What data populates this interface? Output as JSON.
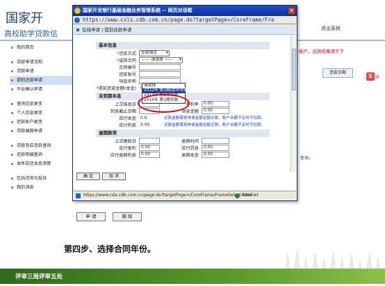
{
  "background": {
    "title": "国家开",
    "subtitle": "高校助学贷款信",
    "exit": "退出系统",
    "sidebar": [
      "我的首页",
      "贷款申请流程",
      "贷款申请",
      "提前还款申请",
      "毕业确认申请",
      "查询信息更变",
      "个人信息更变",
      "还款账户更变",
      "贷款展期申请",
      "贷款及应还款查询",
      "还款明细查询",
      "本年应还本息测算",
      "在线咨询与投诉",
      "我的消息"
    ],
    "red_notice": "账户。还款结果请于下",
    "repay_date_box": "还款日期",
    "right_zhong": "中",
    "blue_notice": "查询。",
    "apply_button": "申 请",
    "delete_button": "删 除"
  },
  "popup": {
    "title": "国家开发银行基层金融业务管理系统 -- 网页对话框",
    "address": "https://www.csls.cdb.com.cn/page.do?targetPage=/CoreFrame/Fra",
    "header": "在线申请 | 提前还款申请",
    "sections": {
      "basic": "基本信息",
      "unexpired": "未到期本息",
      "overdue": "逾期款项"
    },
    "fields": {
      "repay_method_label": "还款方式",
      "repay_method_value": "全部偿还",
      "contract_label": "选择合同",
      "contract_value": "------ 请选择 ------",
      "contract_no_label": "合同编号",
      "repay_account_label": "还款账号",
      "project_name_label": "项目名称",
      "prepay_amount_label": "提前还款金额(本金)",
      "prepay_amount_value": "0.0"
    },
    "dropdown_options": [
      "请选择",
      "2012年 第1期(助学贷款)",
      "2013年 第1期贷款",
      "2014年 第1期贷款"
    ],
    "unexpired_rows": {
      "last_settle_label": "上次结息日",
      "annual_rate_label": "年利率",
      "interest_end_label": "到息截止日期",
      "interest_amount_label": "到息金额",
      "due_principal_label": "应付本金",
      "due_principal_value": "0.0",
      "due_interest_label": "应付利息",
      "due_interest_value": "0.00",
      "note1": "还款金额需按申请金额足额还款，账户余额不足时不扣款。",
      "note2": "还款金额需按申请金额足额还款，账户余额不足时不扣款。",
      "annual_rate_value": "0.00",
      "interest_amount_value": "0.00"
    },
    "overdue_rows": {
      "last_pay_label": "上次缴款日",
      "overdue_time_label": "逾期时间",
      "due_compound_label": "应付复利",
      "due_compound_value": "0.00",
      "due_penalty_label": "应付罚息",
      "due_penalty_value": "0.00",
      "due_overdue_int_label": "应付逾期利息",
      "due_overdue_int_value": "0.00",
      "overdue_principal_label": "逾期本金",
      "overdue_principal_value": "0.00"
    },
    "confirm_button": "确 定",
    "cancel_button": "取 消",
    "status_url": "https://www.csls.cdb.com.cn/page.do?targetPage=/CoreFrame/FrameSelect.html",
    "status_zone": "Internet"
  },
  "slide": {
    "step_text": "第四步、选择合同年份。",
    "footer_text": "评审三局评审五处"
  },
  "colors": {
    "titlebar": "#0b2fa0",
    "footer_green": "#2e6a1c",
    "highlight_red": "#e00000"
  }
}
